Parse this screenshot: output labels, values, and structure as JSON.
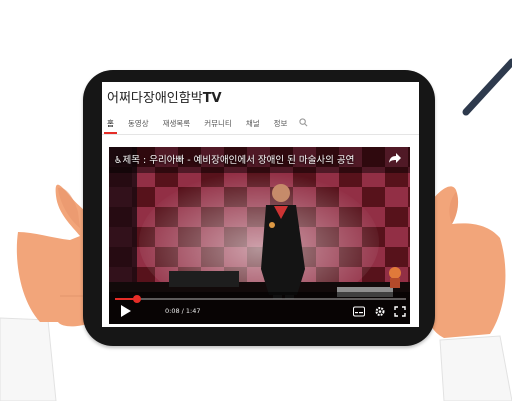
{
  "channel": {
    "title_main": "어쩌다장애인함박",
    "title_suffix": "TV"
  },
  "tabs": [
    {
      "label": "홈",
      "active": true
    },
    {
      "label": "동영상"
    },
    {
      "label": "재생목록"
    },
    {
      "label": "커뮤니티"
    },
    {
      "label": "채널"
    },
    {
      "label": "정보"
    }
  ],
  "search_icon": "search-icon",
  "video": {
    "title": "♿제목 : 우리아빠 - 예비장애인에서 장애인 된 마술사의 공연",
    "current_time": "0:08",
    "duration": "1:47",
    "time_text": "0:08 / 1:47",
    "progress": 0.075
  },
  "icons": [
    "share-icon",
    "play-icon",
    "subtitles-icon",
    "settings-gear-icon",
    "fullscreen-icon"
  ],
  "colors": {
    "accent": "#e52d27",
    "tablet_frame": "#161616",
    "skin": "#f2a57a",
    "sleeve": "#f7f7f7"
  }
}
